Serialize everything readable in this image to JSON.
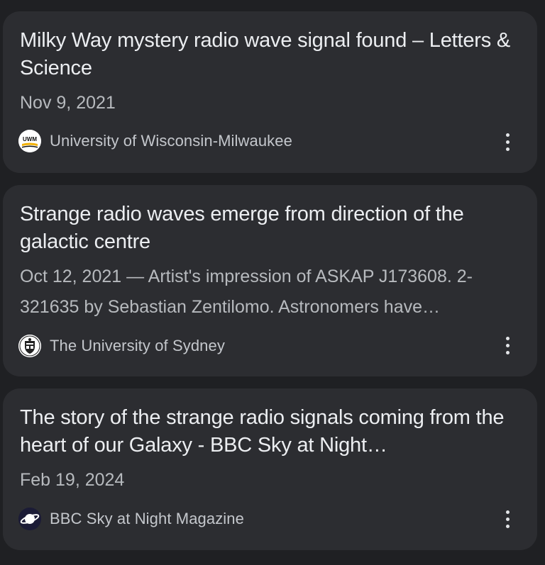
{
  "results": [
    {
      "title": "Milky Way mystery radio wave signal found – Letters & Science",
      "snippet": "Nov 9, 2021",
      "source": "University of Wisconsin-Milwaukee",
      "favicon_icon": "uwm-logo-icon",
      "favicon_text": "UWM"
    },
    {
      "title": "Strange radio waves emerge from direction of the galactic centre",
      "snippet": "Oct 12, 2021 — Artist's impression of ASKAP J173608. 2-321635 by Sebastian Zentilomo. Astronomers have…",
      "source": "The University of Sydney",
      "favicon_icon": "university-crest-icon"
    },
    {
      "title": "The story of the strange radio signals coming from the heart of our Galaxy - BBC Sky at Night…",
      "snippet": "Feb 19, 2024",
      "source": "BBC Sky at Night Magazine",
      "favicon_icon": "planet-icon"
    }
  ],
  "more_options_icon": "more-vert-icon",
  "colors": {
    "background": "#1f2023",
    "card": "#2c2d31",
    "title": "#eceef1",
    "snippet": "#b7babe",
    "source": "#c4c7cc"
  }
}
